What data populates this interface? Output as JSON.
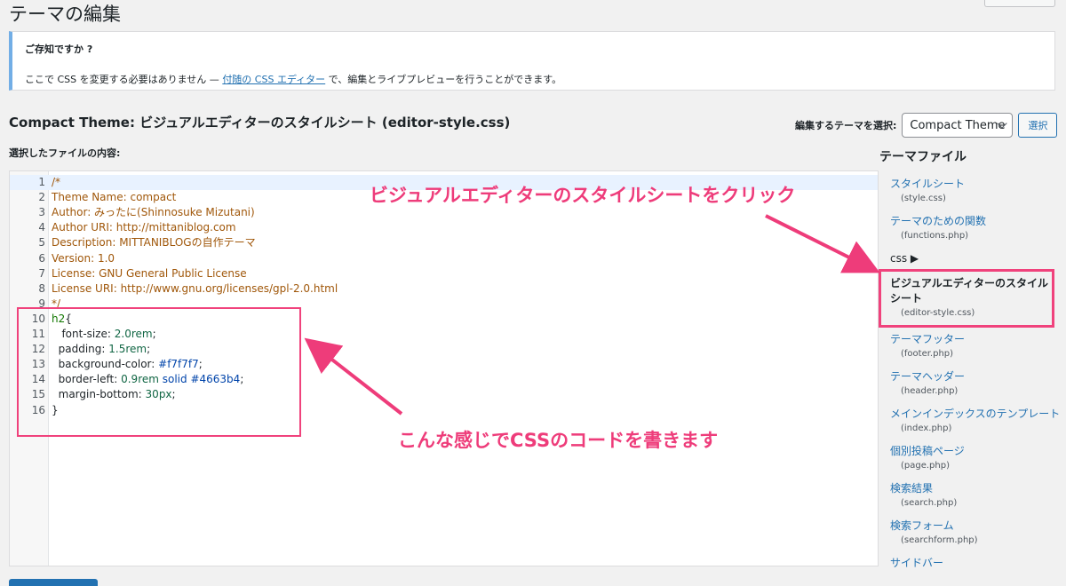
{
  "page_title": "テーマの編集",
  "notice": {
    "title": "ご存知ですか ?",
    "text_before": "ここで CSS を変更する必要はありません — ",
    "link": "付随の CSS エディター",
    "text_after": " で、編集とライブプレビューを行うことができます。"
  },
  "file_heading": "Compact Theme: ビジュアルエディターのスタイルシート (editor-style.css)",
  "theme_select": {
    "label": "編集するテーマを選択:",
    "value": "Compact Theme",
    "button": "選択"
  },
  "content_label": "選択したファイルの内容:",
  "code_lines": [
    {
      "num": "1",
      "code": "/*"
    },
    {
      "num": "2",
      "code": "Theme Name: compact"
    },
    {
      "num": "3",
      "code": "Author: みったに(Shinnosuke Mizutani)"
    },
    {
      "num": "4",
      "code": "Author URI: http://mittaniblog.com"
    },
    {
      "num": "5",
      "code": "Description: MITTANIBLOGの自作テーマ"
    },
    {
      "num": "6",
      "code": "Version: 1.0"
    },
    {
      "num": "7",
      "code": "License: GNU General Public License"
    },
    {
      "num": "8",
      "code": "License URI: http://www.gnu.org/licenses/gpl-2.0.html"
    },
    {
      "num": "9",
      "code": "*/"
    },
    {
      "num": "10",
      "sel": "h2",
      "brace": "{"
    },
    {
      "num": "11",
      "prop": "   font-size: ",
      "val": "2.0rem",
      "end": ";"
    },
    {
      "num": "12",
      "prop": "  padding: ",
      "val": "1.5rem",
      "end": ";"
    },
    {
      "num": "13",
      "prop": "  background-color: ",
      "hash": "#f7f7f7",
      "end": ";"
    },
    {
      "num": "14",
      "prop": "  border-left: ",
      "val": "0.9rem",
      "mid": " solid ",
      "hash": "#4663b4",
      "end": ";"
    },
    {
      "num": "15",
      "prop": "  margin-bottom: ",
      "val": "30px",
      "end": ";"
    },
    {
      "num": "16",
      "code": "}"
    }
  ],
  "annotations": {
    "click_hint": "ビジュアルエディターのスタイルシートをクリック",
    "code_hint": "こんな感じでCSSのコードを書きます"
  },
  "sidebar": {
    "title": "テーマファイル",
    "items_top": [
      {
        "label": "スタイルシート",
        "file": "(style.css)"
      },
      {
        "label": "テーマのための関数",
        "file": "(functions.php)"
      }
    ],
    "css_folder": "css ▶",
    "current": {
      "label": "ビジュアルエディターのスタイル\nシート",
      "line1": "ビジュアルエディターのスタイル",
      "line2": "シート",
      "file": "(editor-style.css)"
    },
    "items_bottom": [
      {
        "label": "テーマフッター",
        "file": "(footer.php)"
      },
      {
        "label": "テーマヘッダー",
        "file": "(header.php)"
      },
      {
        "label": "メインインデックスのテンプレート",
        "file": "(index.php)"
      },
      {
        "label": "個別投稿ページ",
        "file": "(page.php)"
      },
      {
        "label": "検索結果",
        "file": "(search.php)"
      },
      {
        "label": "検索フォーム",
        "file": "(searchform.php)"
      },
      {
        "label": "サイドバー",
        "file": ""
      }
    ]
  },
  "colors": {
    "accent": "#2271b1",
    "annotation": "#ee3c7a"
  }
}
